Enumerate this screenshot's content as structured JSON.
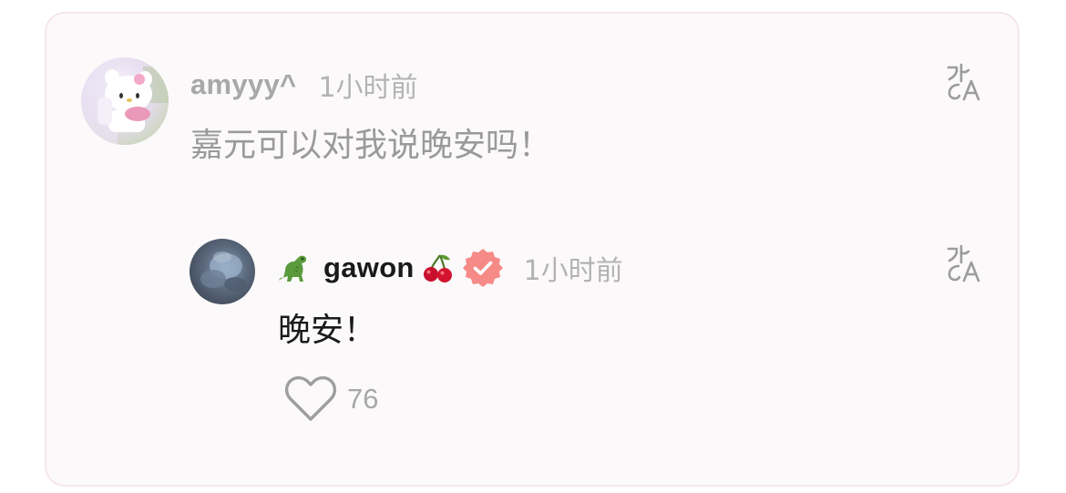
{
  "comment": {
    "username": "amyyy^",
    "time": "1小时前",
    "text": "嘉元可以对我说晚安吗！",
    "avatar": "hello-kitty-avatar",
    "translate_icon": "translate-icon"
  },
  "reply": {
    "prefix_emoji": "🦖",
    "username": "gawon",
    "suffix_emoji": "🍒",
    "verified_badge": "verified-badge-icon",
    "time": "1小时前",
    "text": "晚安！",
    "avatar": "blurred-avatar",
    "translate_icon": "translate-icon",
    "like_icon": "heart-outline-icon",
    "like_count": "76"
  },
  "colors": {
    "card_background": "#fcf9fa",
    "card_border": "#f6e6ec",
    "verified_badge": "#f68a86",
    "muted_text": "#a8a8a8",
    "primary_text": "#1a1a1a"
  }
}
